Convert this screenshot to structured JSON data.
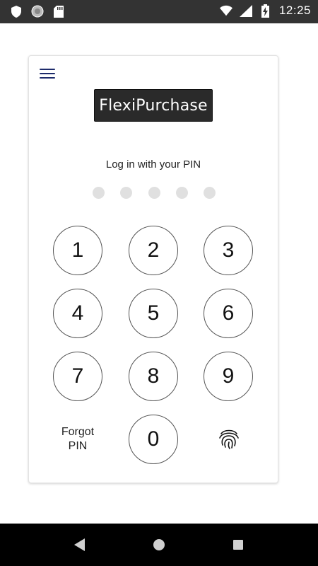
{
  "status_bar": {
    "time": "12:25",
    "icons_left": [
      "shield-icon",
      "circle-icon",
      "sd-card-icon"
    ],
    "icons_right": [
      "wifi-icon",
      "signal-icon",
      "battery-charging-icon"
    ]
  },
  "app": {
    "logo_text": "FlexiPurchase",
    "prompt": "Log in with your PIN",
    "pin_length": 5
  },
  "keypad": {
    "keys": [
      "1",
      "2",
      "3",
      "4",
      "5",
      "6",
      "7",
      "8",
      "9",
      "0"
    ],
    "forgot_label": "Forgot PIN",
    "biometric_icon": "fingerprint-icon"
  },
  "nav_bar": {
    "icons": [
      "back-icon",
      "home-icon",
      "recents-icon"
    ]
  },
  "colors": {
    "status_bar_bg": "#333333",
    "logo_bg": "#2a2a2a",
    "menu_icon": "#1d2b6b",
    "dot_empty": "#e0e0e0",
    "nav_bar_bg": "#000000"
  }
}
